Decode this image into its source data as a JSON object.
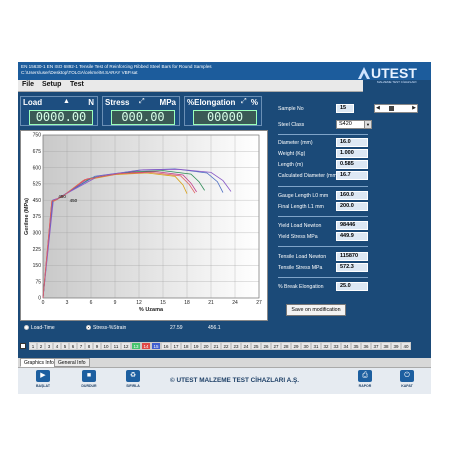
{
  "window": {
    "title_line1": "EN 15630-1 EN ISO 6892-1 Tensile Test of Reinforcing Ribbed Steel Bars for Round Samples",
    "title_line2": "C:\\Users\\user\\Desktop\\TOLGA\\cekme\\M.SARAY VBP.sat"
  },
  "logo": {
    "brand": "UTEST",
    "subtitle": "MALZEME TEST CİHAZLARI"
  },
  "menu": [
    "File",
    "Setup",
    "Test"
  ],
  "meters": {
    "load": {
      "label": "Load",
      "unit": "N",
      "value": "0000.00"
    },
    "stress": {
      "label": "Stress",
      "unit": "MPa",
      "value": "000.00"
    },
    "elongation": {
      "label": "%Elongation",
      "unit": "%",
      "value": "00000"
    }
  },
  "chart_data": {
    "type": "line",
    "title": "",
    "xlabel": "% Uzama",
    "ylabel": "Gerilme (MPa)",
    "xlim": [
      0,
      27
    ],
    "ylim": [
      0,
      750
    ],
    "xticks": [
      "0",
      "3",
      "6",
      "9",
      "12",
      "15",
      "18",
      "21",
      "24",
      "27"
    ],
    "yticks": [
      "0",
      "75",
      "150",
      "225",
      "300",
      "375",
      "450",
      "525",
      "600",
      "675",
      "750"
    ],
    "grid": true,
    "annotations": [
      "450",
      "450"
    ],
    "series": [
      {
        "color": "#d9a21b",
        "x": [
          0,
          1.1,
          1.6,
          2.5,
          5,
          9,
          13,
          16.5,
          17.5,
          18.0
        ],
        "y": [
          0,
          440,
          450,
          470,
          540,
          568,
          575,
          560,
          520,
          480
        ]
      },
      {
        "color": "#c23b8b",
        "x": [
          0,
          1.1,
          1.7,
          2.8,
          5.5,
          10,
          14,
          17.5,
          18.5,
          19.2
        ],
        "y": [
          0,
          445,
          452,
          478,
          548,
          575,
          582,
          566,
          528,
          488
        ]
      },
      {
        "color": "#2e8b57",
        "x": [
          0,
          1.2,
          1.8,
          3.0,
          6,
          11,
          15,
          18.5,
          19.5,
          20.2
        ],
        "y": [
          0,
          448,
          455,
          482,
          552,
          580,
          586,
          570,
          535,
          495
        ]
      },
      {
        "color": "#4b6cc1",
        "x": [
          0,
          1.2,
          1.9,
          3.2,
          6.5,
          12,
          16.5,
          20.5,
          21.8,
          22.5
        ],
        "y": [
          0,
          450,
          458,
          488,
          560,
          588,
          594,
          575,
          535,
          485
        ]
      },
      {
        "color": "#8a5ac7",
        "x": [
          0,
          1.3,
          2.0,
          3.4,
          7,
          12.5,
          17,
          21,
          22.5,
          23.5
        ],
        "y": [
          0,
          452,
          460,
          490,
          562,
          590,
          592,
          578,
          540,
          490
        ]
      },
      {
        "color": "#e06060",
        "x": [
          0,
          1.1,
          1.6,
          2.6,
          5.2,
          9.5,
          13.5,
          17.2,
          18.3,
          19.0
        ],
        "y": [
          0,
          446,
          452,
          472,
          545,
          572,
          578,
          562,
          522,
          482
        ]
      }
    ]
  },
  "under_chart": {
    "opt_load_time": "Load-Time",
    "opt_stress_strain": "Stress-%Strain",
    "readout_x": "27.59",
    "readout_y": "456.1"
  },
  "samples": [
    "1",
    "2",
    "3",
    "4",
    "5",
    "6",
    "7",
    "8",
    "9",
    "10",
    "11",
    "12",
    "13",
    "14",
    "15",
    "16",
    "17",
    "18",
    "19",
    "20",
    "21",
    "22",
    "23",
    "24",
    "25",
    "26",
    "27",
    "28",
    "29",
    "30",
    "31",
    "32",
    "33",
    "34",
    "35",
    "36",
    "37",
    "38",
    "39",
    "40"
  ],
  "sample_colors": {
    "13": "#46c46e",
    "14": "#e04848",
    "15": "#4060d0"
  },
  "panel": {
    "sample_no_label": "Sample No",
    "sample_no_value": "15",
    "steel_class_label": "Steel Class",
    "steel_class_value": "S420",
    "diameter_label": "Diameter (mm)",
    "diameter_value": "16.0",
    "weight_label": "Weight (Kg)",
    "weight_value": "1.000",
    "length_label": "Length (m)",
    "length_value": "0.585",
    "calc_diameter_label": "Calculated Diameter (mm)",
    "calc_diameter_value": "16.7",
    "gauge_label": "Gauge Length L0 mm",
    "gauge_value": "160.0",
    "final_label": "Final Length L1 mm",
    "final_value": "200.0",
    "yield_load_label": "Yield Load Newton",
    "yield_load_value": "98446",
    "yield_stress_label": "Yield Stress MPa",
    "yield_stress_value": "449.9",
    "tensile_load_label": "Tensile Load Newton",
    "tensile_load_value": "115870",
    "tensile_stress_label": "Tensile Stress MPa",
    "tensile_stress_value": "572.3",
    "break_label": "% Break Elongation",
    "break_value": "25.0",
    "save_button": "Save on modification"
  },
  "tabs": [
    "Graphics Info",
    "General Info"
  ],
  "toolbar": {
    "start": "BAŞLAT",
    "stop": "DURDUR",
    "reset": "SIFIRLA",
    "report": "RAPOR",
    "exit": "KAPAT",
    "footer": "© UTEST MALZEME TEST CİHAZLARI A.Ş."
  }
}
